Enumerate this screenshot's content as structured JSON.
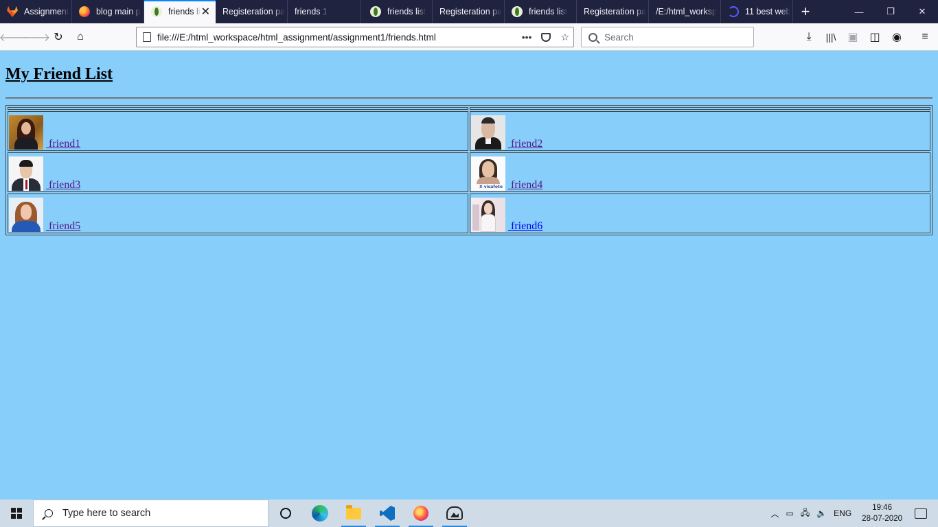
{
  "browser": {
    "tabs": [
      {
        "label": "Assignment",
        "icon": "gitlab-icon",
        "active": false
      },
      {
        "label": "blog main p",
        "icon": "firefox-icon",
        "active": false
      },
      {
        "label": "friends li",
        "icon": "leaf-icon",
        "active": true
      },
      {
        "label": "Registeration pa",
        "icon": "none",
        "active": false
      },
      {
        "label": "friends 1",
        "icon": "none",
        "active": false
      },
      {
        "label": "friends list",
        "icon": "leaf-icon",
        "active": false
      },
      {
        "label": "Registeration pa",
        "icon": "none",
        "active": false
      },
      {
        "label": "friends list",
        "icon": "leaf-icon",
        "active": false
      },
      {
        "label": "Registeration pa",
        "icon": "none",
        "active": false
      },
      {
        "label": "/E:/html_worksp",
        "icon": "none",
        "active": false
      },
      {
        "label": "11 best web",
        "icon": "swirl-icon",
        "active": false
      }
    ],
    "new_tab_glyph": "+",
    "url": "file:///E:/html_workspace/html_assignment/assignment1/friends.html",
    "search_placeholder": "Search",
    "page_actions_glyph": "•••"
  },
  "page": {
    "title": "My Friend List",
    "friends": [
      {
        "name": " friend1",
        "visited": true
      },
      {
        "name": " friend2",
        "visited": true
      },
      {
        "name": " friend3",
        "visited": true
      },
      {
        "name": " friend4",
        "visited": true
      },
      {
        "name": " friend5",
        "visited": true
      },
      {
        "name": " friend6",
        "visited": false
      }
    ],
    "photo_logo_text": "X visafoto"
  },
  "taskbar": {
    "search_placeholder": "Type here to search",
    "language": "ENG",
    "time": "19:46",
    "date": "28-07-2020"
  },
  "colors": {
    "page_background": "#87cefa",
    "visited_link": "#551a8b",
    "unvisited_link": "#0000ee",
    "tabstrip": "#202340",
    "active_tab_accent": "#0a84ff"
  }
}
